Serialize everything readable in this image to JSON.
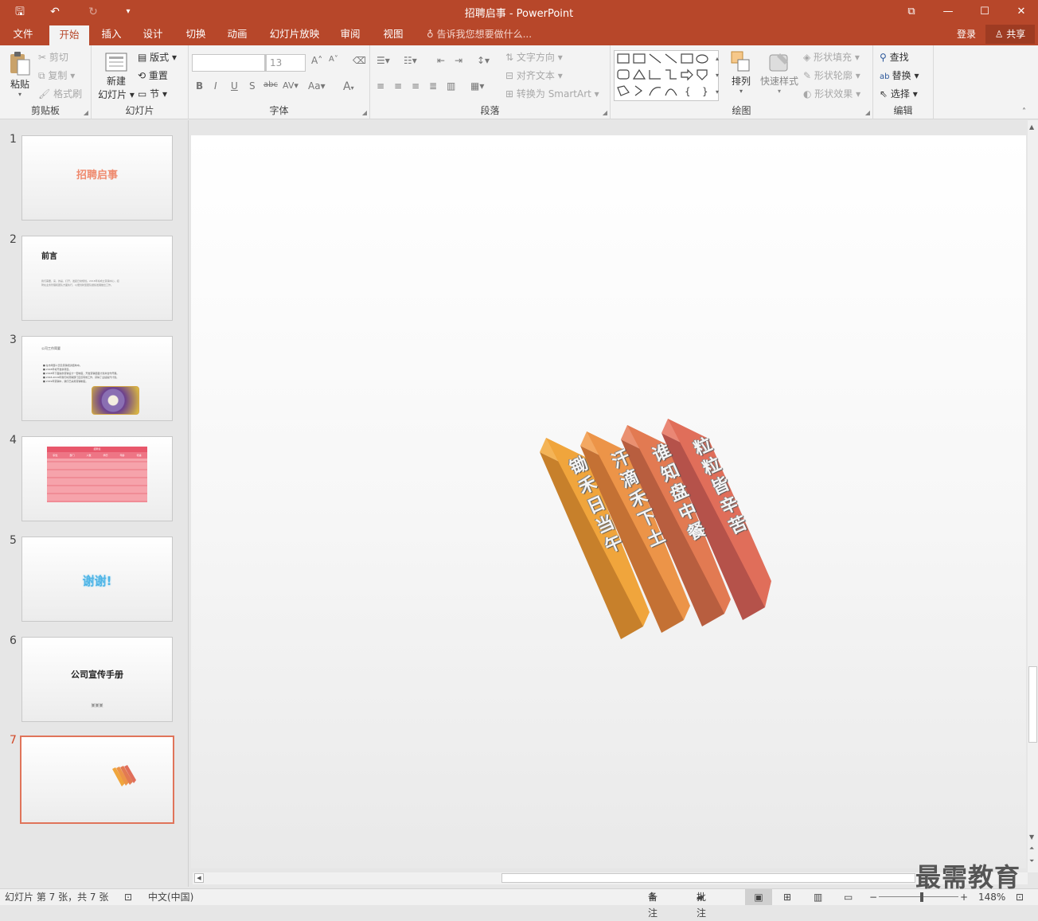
{
  "titlebar": {
    "title": "招聘启事 - PowerPoint",
    "qa_save": "🖫",
    "qa_undo": "↶",
    "qa_redo": "↻",
    "qa_custom": "▾",
    "ribbon_options": "⧉",
    "minimize": "—",
    "maximize": "☐",
    "close": "✕"
  },
  "tabs": {
    "file": "文件",
    "items": [
      "开始",
      "插入",
      "设计",
      "切换",
      "动画",
      "幻灯片放映",
      "审阅",
      "视图"
    ],
    "tell_me": "告诉我您想要做什么...",
    "login": "登录",
    "share": "共享"
  },
  "ribbon": {
    "clipboard": {
      "label": "剪贴板",
      "paste": "粘贴",
      "cut": "剪切",
      "copy": "复制",
      "format_painter": "格式刷"
    },
    "slides": {
      "label": "幻灯片",
      "new_slide_1": "新建",
      "new_slide_2": "幻灯片",
      "layout": "版式",
      "reset": "重置",
      "section": "节"
    },
    "font": {
      "label": "字体",
      "font_name": "",
      "font_size": "13",
      "bold": "B",
      "italic": "I",
      "underline": "U",
      "shadow": "S",
      "strike": "abc",
      "spacing": "AV",
      "case": "Aa",
      "color": "A",
      "grow": "A",
      "shrink": "A"
    },
    "paragraph": {
      "label": "段落",
      "text_direction": "文字方向",
      "align_text": "对齐文本",
      "smartart": "转换为 SmartArt"
    },
    "drawing": {
      "label": "绘图",
      "arrange": "排列",
      "quick_styles": "快速样式",
      "fill": "形状填充",
      "outline": "形状轮廓",
      "effects": "形状效果"
    },
    "editing": {
      "label": "编辑",
      "find": "查找",
      "replace": "替换",
      "select": "选择"
    }
  },
  "thumbnails": [
    {
      "num": "1",
      "title": "招聘启事"
    },
    {
      "num": "2",
      "title": "前言",
      "body": "我们需要，来，的是，打开，发起日常规划。2018年将成立营销中心，招聘在业务管理和团队方面执行，以便创新型团队继续发展做出工作。"
    },
    {
      "num": "3",
      "title": "公司工作简要",
      "bullets": [
        "在市场部人员及营销培训结构中。",
        "2018年将开发新项目。",
        "2018年下面提供营销设计一套制度，开发营销层面计划并合作开展。",
        "2018-2019年我们将营销部门应该有效工作，获得了业绩提升计划。",
        "2019年营销中，我们已采用营销制度。"
      ]
    },
    {
      "num": "4",
      "table_title": "招聘表",
      "table_headers": [
        "职位",
        "部门",
        "人数",
        "学历",
        "年龄",
        "待遇"
      ]
    },
    {
      "num": "5",
      "title": "谢谢!"
    },
    {
      "num": "6",
      "title": "公司宣传手册",
      "subtitle": "某某某"
    },
    {
      "num": "7"
    }
  ],
  "slide": {
    "banners": [
      {
        "text": "锄禾日当午",
        "color": "#f0a53c"
      },
      {
        "text": "汗滴禾下土",
        "color": "#ec9448"
      },
      {
        "text": "谁知盘中餐",
        "color": "#e27a52"
      },
      {
        "text": "粒粒皆辛苦",
        "color": "#e06e5a"
      }
    ]
  },
  "status": {
    "slide_info": "幻灯片 第 7 张，共 7 张",
    "language": "中文(中国)",
    "notes": "备注",
    "comments": "批注",
    "zoom": "148%"
  },
  "watermark": "最需教育"
}
